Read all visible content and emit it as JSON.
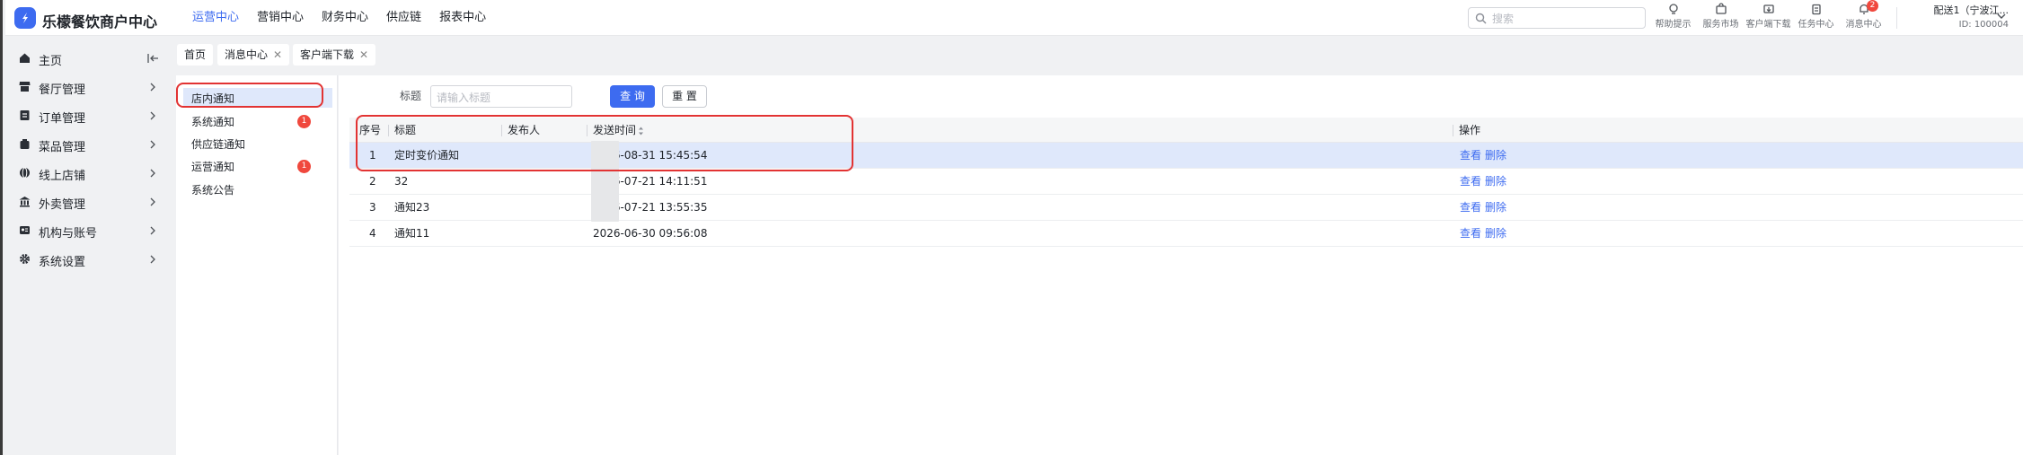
{
  "app": {
    "brand": "乐檬餐饮商户中心"
  },
  "topnav": [
    "运营中心",
    "营销中心",
    "财务中心",
    "供应链",
    "报表中心"
  ],
  "search": {
    "placeholder": "搜索"
  },
  "tools": [
    {
      "label": "帮助提示",
      "icon": "bulb-icon"
    },
    {
      "label": "服务市场",
      "icon": "shop-bag-icon"
    },
    {
      "label": "客户端下载",
      "icon": "download-icon"
    },
    {
      "label": "任务中心",
      "icon": "clipboard-icon"
    },
    {
      "label": "消息中心",
      "icon": "bell-icon",
      "badge": "2"
    }
  ],
  "account": {
    "name": "配送1（宁波江...",
    "id": "ID: 100004"
  },
  "sidebar": {
    "items": [
      {
        "label": "主页",
        "icon": "home-icon"
      },
      {
        "label": "餐厅管理",
        "icon": "store-icon"
      },
      {
        "label": "订单管理",
        "icon": "order-icon"
      },
      {
        "label": "菜品管理",
        "icon": "dish-icon"
      },
      {
        "label": "线上店铺",
        "icon": "globe-icon"
      },
      {
        "label": "外卖管理",
        "icon": "bank-icon"
      },
      {
        "label": "机构与账号",
        "icon": "id-card-icon"
      },
      {
        "label": "系统设置",
        "icon": "gear-icon"
      }
    ]
  },
  "tabs": [
    {
      "label": "首页",
      "closable": false
    },
    {
      "label": "消息中心",
      "closable": true
    },
    {
      "label": "客户端下载",
      "closable": true
    }
  ],
  "messages": {
    "categories": [
      {
        "label": "店内通知",
        "selected": true
      },
      {
        "label": "系统通知",
        "badge": "1"
      },
      {
        "label": "供应链通知"
      },
      {
        "label": "运营通知",
        "badge": "1"
      },
      {
        "label": "系统公告"
      }
    ]
  },
  "filter": {
    "title_label": "标题",
    "title_placeholder": "请输入标题",
    "query_label": "查 询",
    "reset_label": "重 置"
  },
  "table": {
    "headers": {
      "index": "序号",
      "title": "标题",
      "publisher": "发布人",
      "sent_time": "发送时间",
      "actions": "操作"
    },
    "action_view": "查看",
    "action_delete": "删除",
    "rows": [
      {
        "index": "1",
        "title": "定时变价通知",
        "publisher": "",
        "sent_time": "2026-08-31 15:45:54"
      },
      {
        "index": "2",
        "title": "32",
        "publisher": "",
        "sent_time": "2026-07-21 14:11:51"
      },
      {
        "index": "3",
        "title": "通知23",
        "publisher": "",
        "sent_time": "2026-07-21 13:55:35"
      },
      {
        "index": "4",
        "title": "通知11",
        "publisher": "",
        "sent_time": "2026-06-30 09:56:08"
      }
    ]
  },
  "colors": {
    "accent": "#3d6bf0",
    "badge": "#f0483d",
    "highlight_row": "#dfe8fb",
    "annotation": "#e23333"
  }
}
